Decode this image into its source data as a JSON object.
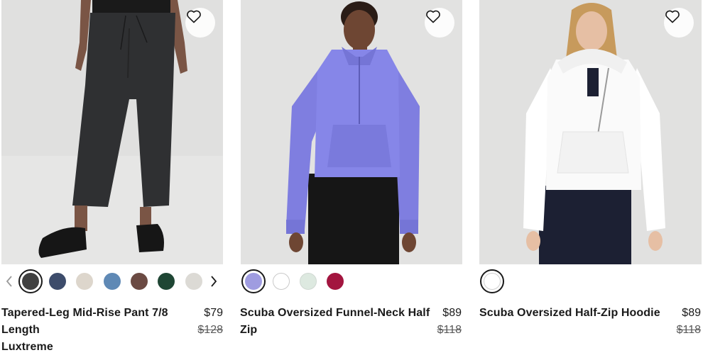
{
  "products": [
    {
      "name_lines": [
        "Tapered-Leg Mid-Rise Pant 7/8",
        "Length",
        "Luxtreme"
      ],
      "price": "$79",
      "original_price": "$128",
      "swatches": [
        "#404040",
        "#3d4c6b",
        "#ddd6cc",
        "#5f89b5",
        "#6b4a43",
        "#1f4634",
        "#dcdad5"
      ],
      "selected_swatch": 0,
      "has_prev_arrow": true,
      "has_next_arrow": true,
      "wishlist_icon": "heart-icon"
    },
    {
      "name_lines": [
        "Scuba Oversized Funnel-Neck Half",
        "Zip"
      ],
      "price": "$89",
      "original_price": "$118",
      "swatches": [
        "#9f9ce0",
        "#ffffff",
        "#dde9e0",
        "#a3153f"
      ],
      "selected_swatch": 0,
      "wishlist_icon": "heart-icon"
    },
    {
      "name_lines": [
        "Scuba Oversized Half-Zip Hoodie"
      ],
      "price": "$89",
      "original_price": "$118",
      "swatches": [
        "#ffffff"
      ],
      "selected_swatch": 0,
      "wishlist_icon": "heart-icon"
    }
  ]
}
